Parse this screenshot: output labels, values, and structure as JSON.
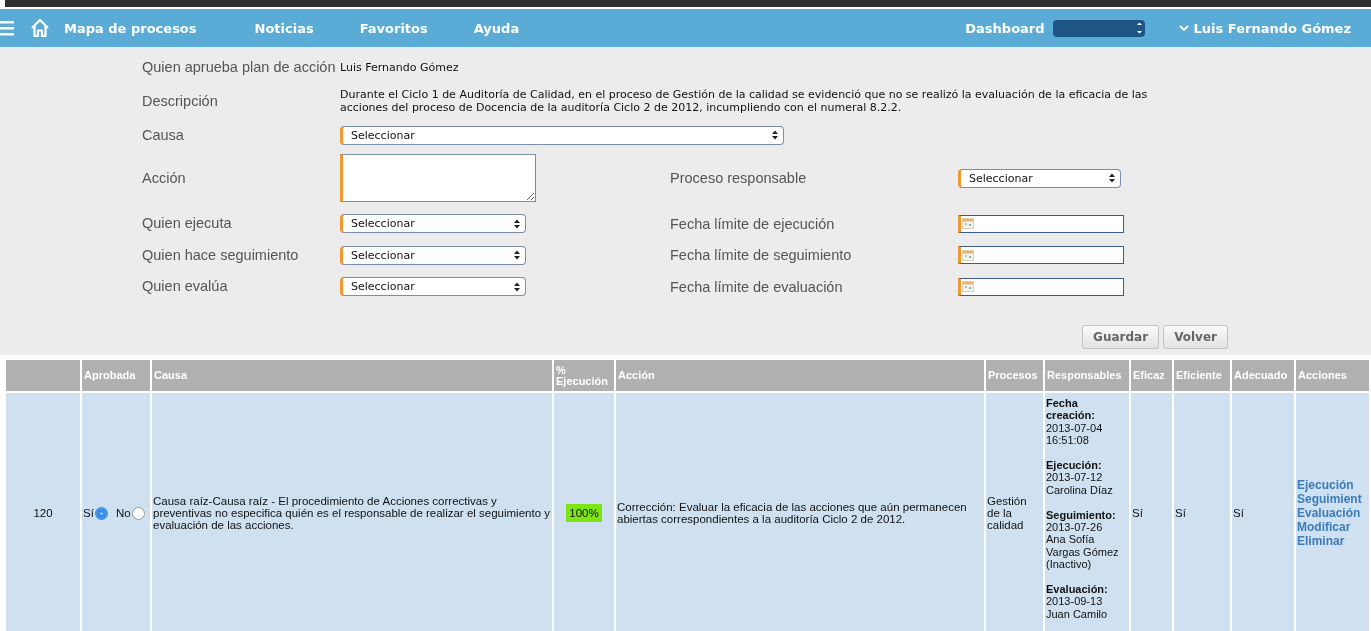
{
  "nav": {
    "menu_items": [
      "Mapa de procesos",
      "Noticias",
      "Favoritos",
      "Ayuda"
    ],
    "dashboard_label": "Dashboard",
    "user": "Luis Fernando Gómez"
  },
  "form": {
    "approver": {
      "label": "Quien aprueba plan de acción",
      "value": "Luis Fernando Gómez"
    },
    "description": {
      "label": "Descripción",
      "value": "Durante el Ciclo 1 de Auditoría de Calidad, en el proceso de Gestión de la calidad se evidenció que no se realizó la evaluación de la eficacia de las acciones del proceso de Docencia de la auditoría Ciclo 2 de 2012, incumpliendo con el numeral 8.2.2."
    },
    "cause": {
      "label": "Causa",
      "value": "Seleccionar"
    },
    "action": {
      "label": "Acción"
    },
    "left_fields": [
      {
        "label": "Quien ejecuta",
        "value": "Seleccionar"
      },
      {
        "label": "Quien hace seguimiento",
        "value": "Seleccionar"
      },
      {
        "label": "Quien evalúa",
        "value": "Seleccionar"
      }
    ],
    "process": {
      "label": "Proceso responsable",
      "value": "Seleccionar"
    },
    "date_fields": [
      {
        "label": "Fecha límite de ejecución"
      },
      {
        "label": "Fecha límite de seguimiento"
      },
      {
        "label": "Fecha límite de evaluación"
      }
    ],
    "buttons": [
      "Guardar",
      "Volver"
    ]
  },
  "table": {
    "columns": [
      "Aprobada",
      "Causa",
      "% Ejecución",
      "Acción",
      "Procesos",
      "Responsables",
      "Eficaz",
      "Eficiente",
      "Adecuado",
      "Acciones"
    ],
    "rows": [
      {
        "id": "120",
        "approval": [
          {
            "label": "Sí",
            "selected": true
          },
          {
            "label": "No",
            "selected": false
          }
        ],
        "cause": "Causa raíz-Causa raíz - El procedimiento de Acciones correctivas y preventivas no especifica quién es el responsable de realizar el seguimiento y evaluación de las acciones.",
        "execution": "100%",
        "action": "Corrección: Evaluar la eficacia de las acciones que aún permanecen abiertas correspondientes a la auditoría Ciclo 2 de 2012.",
        "process": "Gestión de la calidad",
        "responsibles": [
          {
            "label": "Fecha creación:",
            "lines": [
              "2013-07-04 16:51:08"
            ]
          },
          {
            "label": "Ejecución:",
            "lines": [
              "2013-07-12",
              "Carolina Díaz"
            ]
          },
          {
            "label": "Seguimiento:",
            "lines": [
              "2013-07-26",
              "Ana Sofía Vargas Gómez (Inactivo)"
            ]
          },
          {
            "label": "Evaluación:",
            "lines": [
              "2013-09-13",
              "Juan Camilo"
            ]
          }
        ],
        "effective": "Sí",
        "efficient": "Sí",
        "adequate": "Sí",
        "links": [
          "Ejecución",
          "Seguimient",
          "Evaluación",
          "Modificar",
          "Eliminar"
        ]
      }
    ]
  }
}
